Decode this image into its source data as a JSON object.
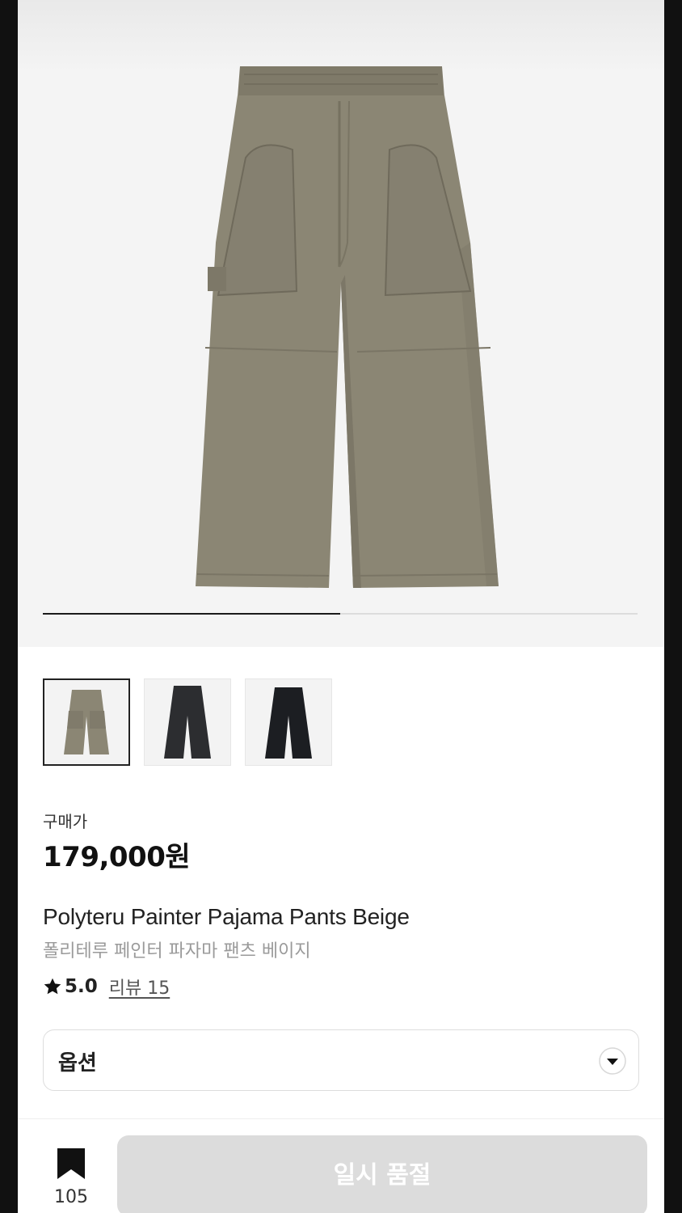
{
  "product": {
    "gallery": {
      "progress_fraction": 0.5,
      "thumbnails": [
        {
          "name": "beige",
          "color": "#8b8674",
          "active": true
        },
        {
          "name": "charcoal",
          "color": "#2c2d30",
          "active": false
        },
        {
          "name": "black",
          "color": "#1c1e22",
          "active": false
        }
      ]
    },
    "price_label": "구매가",
    "price": "179,000원",
    "name_en": "Polyteru Painter Pajama Pants Beige",
    "name_ko": "폴리테루 페인터 파자마 팬츠 베이지",
    "rating": {
      "icon": "star-icon",
      "value": "5.0",
      "review_label": "리뷰 15"
    },
    "option": {
      "label": "옵션",
      "icon": "chevron-down-icon"
    }
  },
  "bottom_bar": {
    "bookmark": {
      "icon": "bookmark-icon",
      "count": "105"
    },
    "cta_label": "일시 품절",
    "cta_color": "#dcdcdc"
  },
  "colors": {
    "pants_beige": "#8b8674",
    "accent": "#1a1a1a"
  }
}
